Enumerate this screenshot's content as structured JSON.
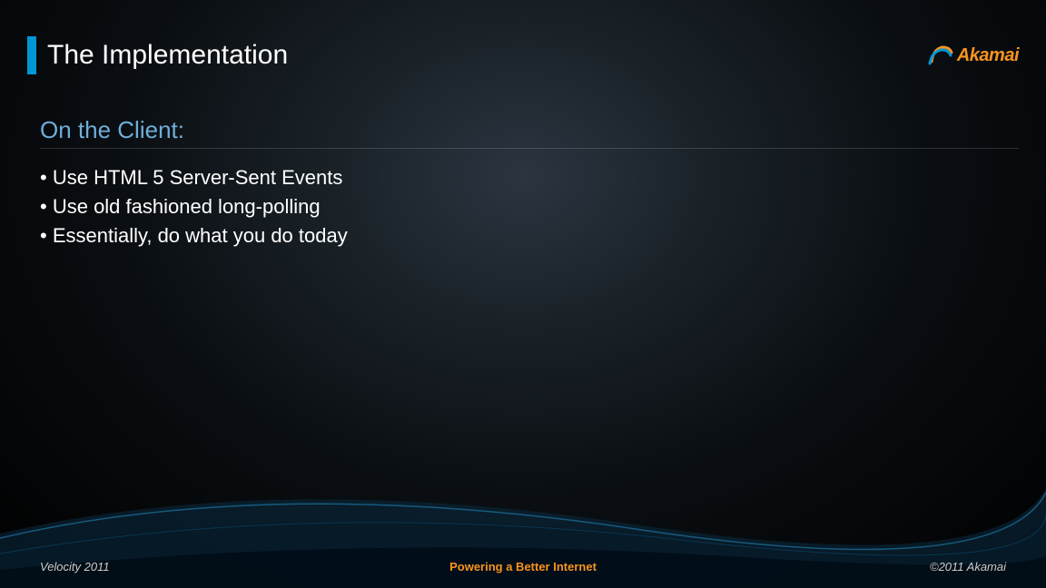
{
  "header": {
    "title": "The Implementation",
    "logo_text": "Akamai"
  },
  "content": {
    "subtitle": "On the Client:",
    "bullets": [
      "Use HTML 5 Server-Sent Events",
      "Use old fashioned long-polling",
      "Essentially, do what you do today"
    ]
  },
  "footer": {
    "left": "Velocity 2011",
    "center": "Powering a Better Internet",
    "right": "©2011 Akamai"
  }
}
